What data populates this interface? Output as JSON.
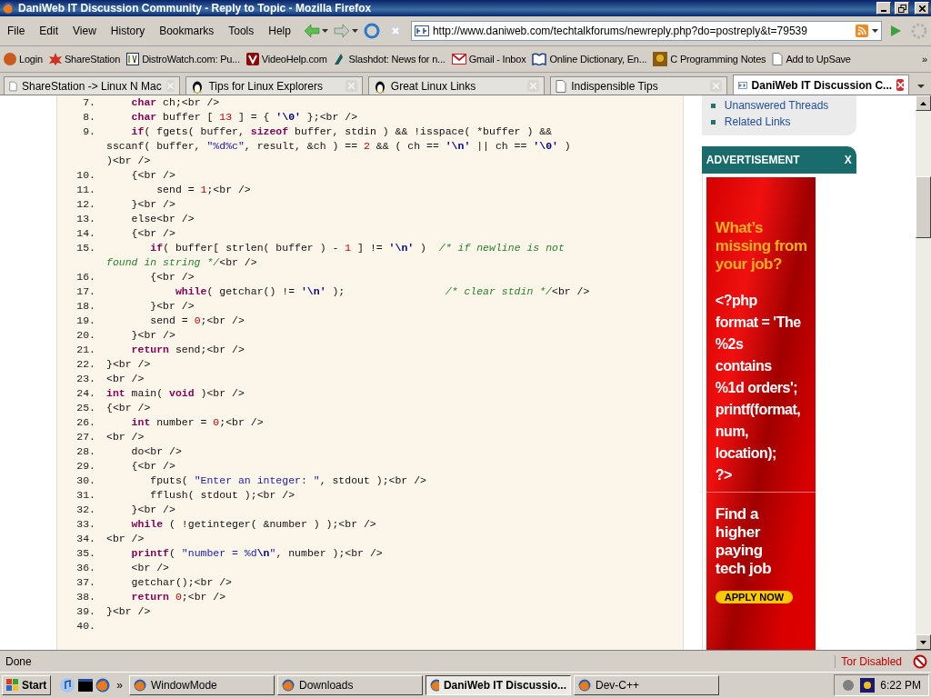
{
  "window": {
    "title": "DaniWeb IT Discussion Community - Reply to Topic - Mozilla Firefox"
  },
  "menu": [
    "File",
    "Edit",
    "View",
    "History",
    "Bookmarks",
    "Tools",
    "Help"
  ],
  "address_bar": {
    "value": "http://www.daniweb.com/techtalkforums/newreply.php?do=postreply&t=79539"
  },
  "bookmarks": [
    "Login",
    "ShareStation",
    "DistroWatch.com: Pu...",
    "VideoHelp.com",
    "Slashdot: News for n...",
    "Gmail - Inbox",
    "Online Dictionary, En...",
    "C Programming Notes",
    "Add to UpSave"
  ],
  "bookmarks_more": "»",
  "tabs": [
    {
      "label": "ShareStation -> Linux N Mac",
      "selected": false
    },
    {
      "label": "Tips for Linux Explorers",
      "selected": false
    },
    {
      "label": "Great Linux Links",
      "selected": false
    },
    {
      "label": "Indispensible Tips",
      "selected": false
    },
    {
      "label": "DaniWeb IT Discussion C...",
      "selected": true
    }
  ],
  "code": [
    {
      "number": "7.",
      "rows": [
        {
          "segments": [
            {
              "kind": "keyword",
              "text": "    char"
            },
            {
              "kind": "plain",
              "text": " ch;<br />"
            }
          ]
        }
      ]
    },
    {
      "number": "8.",
      "rows": [
        {
          "segments": [
            {
              "kind": "keyword",
              "text": "    char"
            },
            {
              "kind": "plain",
              "text": " buffer [ "
            },
            {
              "kind": "number",
              "text": "13"
            },
            {
              "kind": "plain",
              "text": " ] = { "
            },
            {
              "kind": "char",
              "text": "'\\0'"
            },
            {
              "kind": "plain",
              "text": " };<br />"
            }
          ]
        }
      ]
    },
    {
      "number": "9.",
      "rows": [
        {
          "segments": [
            {
              "kind": "keyword",
              "text": "    if"
            },
            {
              "kind": "plain",
              "text": "( fgets( buffer, "
            },
            {
              "kind": "keyword",
              "text": "sizeof"
            },
            {
              "kind": "plain",
              "text": " buffer, stdin ) && !isspace( *buffer ) &&"
            }
          ]
        },
        {
          "segments": [
            {
              "kind": "plain",
              "text": "sscanf( buffer, "
            },
            {
              "kind": "string",
              "text": "\"%d%c\""
            },
            {
              "kind": "plain",
              "text": ", result, &ch ) == "
            },
            {
              "kind": "number",
              "text": "2"
            },
            {
              "kind": "plain",
              "text": " && ( ch == "
            },
            {
              "kind": "char",
              "text": "'\\n'"
            },
            {
              "kind": "plain",
              "text": " || ch == "
            },
            {
              "kind": "char",
              "text": "'\\0'"
            },
            {
              "kind": "plain",
              "text": " )"
            }
          ]
        },
        {
          "segments": [
            {
              "kind": "plain",
              "text": ")<br />"
            }
          ]
        }
      ]
    },
    {
      "number": "10.",
      "rows": [
        {
          "segments": [
            {
              "kind": "plain",
              "text": "    {<br />"
            }
          ]
        }
      ]
    },
    {
      "number": "11.",
      "rows": [
        {
          "segments": [
            {
              "kind": "plain",
              "text": "        send = "
            },
            {
              "kind": "number",
              "text": "1"
            },
            {
              "kind": "plain",
              "text": ";<br />"
            }
          ]
        }
      ]
    },
    {
      "number": "12.",
      "rows": [
        {
          "segments": [
            {
              "kind": "plain",
              "text": "    }<br />"
            }
          ]
        }
      ]
    },
    {
      "number": "13.",
      "rows": [
        {
          "segments": [
            {
              "kind": "plain",
              "text": "    else<br />"
            }
          ]
        }
      ]
    },
    {
      "number": "14.",
      "rows": [
        {
          "segments": [
            {
              "kind": "plain",
              "text": "    {<br />"
            }
          ]
        }
      ]
    },
    {
      "number": "15.",
      "rows": [
        {
          "segments": [
            {
              "kind": "keyword",
              "text": "       if"
            },
            {
              "kind": "plain",
              "text": "( buffer[ strlen( buffer ) - "
            },
            {
              "kind": "number",
              "text": "1"
            },
            {
              "kind": "plain",
              "text": " ] != "
            },
            {
              "kind": "char",
              "text": "'\\n'"
            },
            {
              "kind": "plain",
              "text": " )  "
            },
            {
              "kind": "comment",
              "text": "/* if newline is not"
            }
          ]
        },
        {
          "segments": [
            {
              "kind": "comment",
              "text": "found in string */"
            },
            {
              "kind": "plain",
              "text": "<br />"
            }
          ]
        }
      ]
    },
    {
      "number": "16.",
      "rows": [
        {
          "segments": [
            {
              "kind": "plain",
              "text": "       {<br />"
            }
          ]
        }
      ]
    },
    {
      "number": "17.",
      "rows": [
        {
          "segments": [
            {
              "kind": "keyword",
              "text": "           while"
            },
            {
              "kind": "plain",
              "text": "( getchar() != "
            },
            {
              "kind": "char",
              "text": "'\\n'"
            },
            {
              "kind": "plain",
              "text": " );                "
            },
            {
              "kind": "comment",
              "text": "/* clear stdin */"
            },
            {
              "kind": "plain",
              "text": "<br />"
            }
          ]
        }
      ]
    },
    {
      "number": "18.",
      "rows": [
        {
          "segments": [
            {
              "kind": "plain",
              "text": "       }<br />"
            }
          ]
        }
      ]
    },
    {
      "number": "19.",
      "rows": [
        {
          "segments": [
            {
              "kind": "plain",
              "text": "       send = "
            },
            {
              "kind": "number",
              "text": "0"
            },
            {
              "kind": "plain",
              "text": ";<br />"
            }
          ]
        }
      ]
    },
    {
      "number": "20.",
      "rows": [
        {
          "segments": [
            {
              "kind": "plain",
              "text": "    }<br />"
            }
          ]
        }
      ]
    },
    {
      "number": "21.",
      "rows": [
        {
          "segments": [
            {
              "kind": "keyword",
              "text": "    return"
            },
            {
              "kind": "plain",
              "text": " send;<br />"
            }
          ]
        }
      ]
    },
    {
      "number": "22.",
      "rows": [
        {
          "segments": [
            {
              "kind": "plain",
              "text": "}<br />"
            }
          ]
        }
      ]
    },
    {
      "number": "23.",
      "rows": [
        {
          "segments": [
            {
              "kind": "plain",
              "text": "<br />"
            }
          ]
        }
      ]
    },
    {
      "number": "24.",
      "rows": [
        {
          "segments": [
            {
              "kind": "keyword",
              "text": "int"
            },
            {
              "kind": "plain",
              "text": " main( "
            },
            {
              "kind": "keyword",
              "text": "void"
            },
            {
              "kind": "plain",
              "text": " )<br />"
            }
          ]
        }
      ]
    },
    {
      "number": "25.",
      "rows": [
        {
          "segments": [
            {
              "kind": "plain",
              "text": "{<br />"
            }
          ]
        }
      ]
    },
    {
      "number": "26.",
      "rows": [
        {
          "segments": [
            {
              "kind": "keyword",
              "text": "    int"
            },
            {
              "kind": "plain",
              "text": " number = "
            },
            {
              "kind": "number",
              "text": "0"
            },
            {
              "kind": "plain",
              "text": ";<br />"
            }
          ]
        }
      ]
    },
    {
      "number": "27.",
      "rows": [
        {
          "segments": [
            {
              "kind": "plain",
              "text": "<br />"
            }
          ]
        }
      ]
    },
    {
      "number": "28.",
      "rows": [
        {
          "segments": [
            {
              "kind": "plain",
              "text": "    do<br />"
            }
          ]
        }
      ]
    },
    {
      "number": "29.",
      "rows": [
        {
          "segments": [
            {
              "kind": "plain",
              "text": "    {<br />"
            }
          ]
        }
      ]
    },
    {
      "number": "30.",
      "rows": [
        {
          "segments": [
            {
              "kind": "plain",
              "text": "       fputs( "
            },
            {
              "kind": "string",
              "text": "\"Enter an integer: \""
            },
            {
              "kind": "plain",
              "text": ", stdout );<br />"
            }
          ]
        }
      ]
    },
    {
      "number": "31.",
      "rows": [
        {
          "segments": [
            {
              "kind": "plain",
              "text": "       fflush( stdout );<br />"
            }
          ]
        }
      ]
    },
    {
      "number": "32.",
      "rows": [
        {
          "segments": [
            {
              "kind": "plain",
              "text": "    }<br />"
            }
          ]
        }
      ]
    },
    {
      "number": "33.",
      "rows": [
        {
          "segments": [
            {
              "kind": "keyword",
              "text": "    while"
            },
            {
              "kind": "plain",
              "text": " ( !getinteger( &number ) );<br />"
            }
          ]
        }
      ]
    },
    {
      "number": "34.",
      "rows": [
        {
          "segments": [
            {
              "kind": "plain",
              "text": "<br />"
            }
          ]
        }
      ]
    },
    {
      "number": "35.",
      "rows": [
        {
          "segments": [
            {
              "kind": "keyword",
              "text": "    printf"
            },
            {
              "kind": "plain",
              "text": "( "
            },
            {
              "kind": "string",
              "text": "\"number = %d"
            },
            {
              "kind": "char",
              "text": "\\n"
            },
            {
              "kind": "string",
              "text": "\""
            },
            {
              "kind": "plain",
              "text": ", number );<br />"
            }
          ]
        }
      ]
    },
    {
      "number": "36.",
      "rows": [
        {
          "segments": [
            {
              "kind": "plain",
              "text": "    <br />"
            }
          ]
        }
      ]
    },
    {
      "number": "37.",
      "rows": [
        {
          "segments": [
            {
              "kind": "plain",
              "text": "    getchar();<br />"
            }
          ]
        }
      ]
    },
    {
      "number": "38.",
      "rows": [
        {
          "segments": [
            {
              "kind": "keyword",
              "text": "    return"
            },
            {
              "kind": "number",
              "text": " 0"
            },
            {
              "kind": "plain",
              "text": ";<br />"
            }
          ]
        }
      ]
    },
    {
      "number": "39.",
      "rows": [
        {
          "segments": [
            {
              "kind": "plain",
              "text": "}<br />"
            }
          ]
        }
      ]
    },
    {
      "number": "40."
    }
  ],
  "sidebar_links": [
    "Unanswered Threads",
    "Related Links"
  ],
  "advertisement": {
    "title": "ADVERTISEMENT",
    "close": "X",
    "headline": [
      "What’s",
      "missing from",
      "your job?"
    ],
    "code_lines": [
      "<?php",
      "format = 'The",
      "%2s",
      "contains",
      "%1d orders';",
      "printf(format,",
      "num,",
      "location);",
      "?>"
    ],
    "tagline": [
      "Find a",
      "higher",
      "paying",
      "tech job"
    ],
    "button": "APPLY NOW"
  },
  "status_bar": {
    "text": "Done",
    "tor": "Tor Disabled"
  },
  "taskbar": {
    "start": "Start",
    "more": "»",
    "items": [
      {
        "label": "WindowMode",
        "selected": false
      },
      {
        "label": "Downloads",
        "selected": false
      },
      {
        "label": "DaniWeb IT Discussio...",
        "selected": true
      },
      {
        "label": "Dev-C++",
        "selected": false
      }
    ],
    "clock": "6:22 PM"
  }
}
